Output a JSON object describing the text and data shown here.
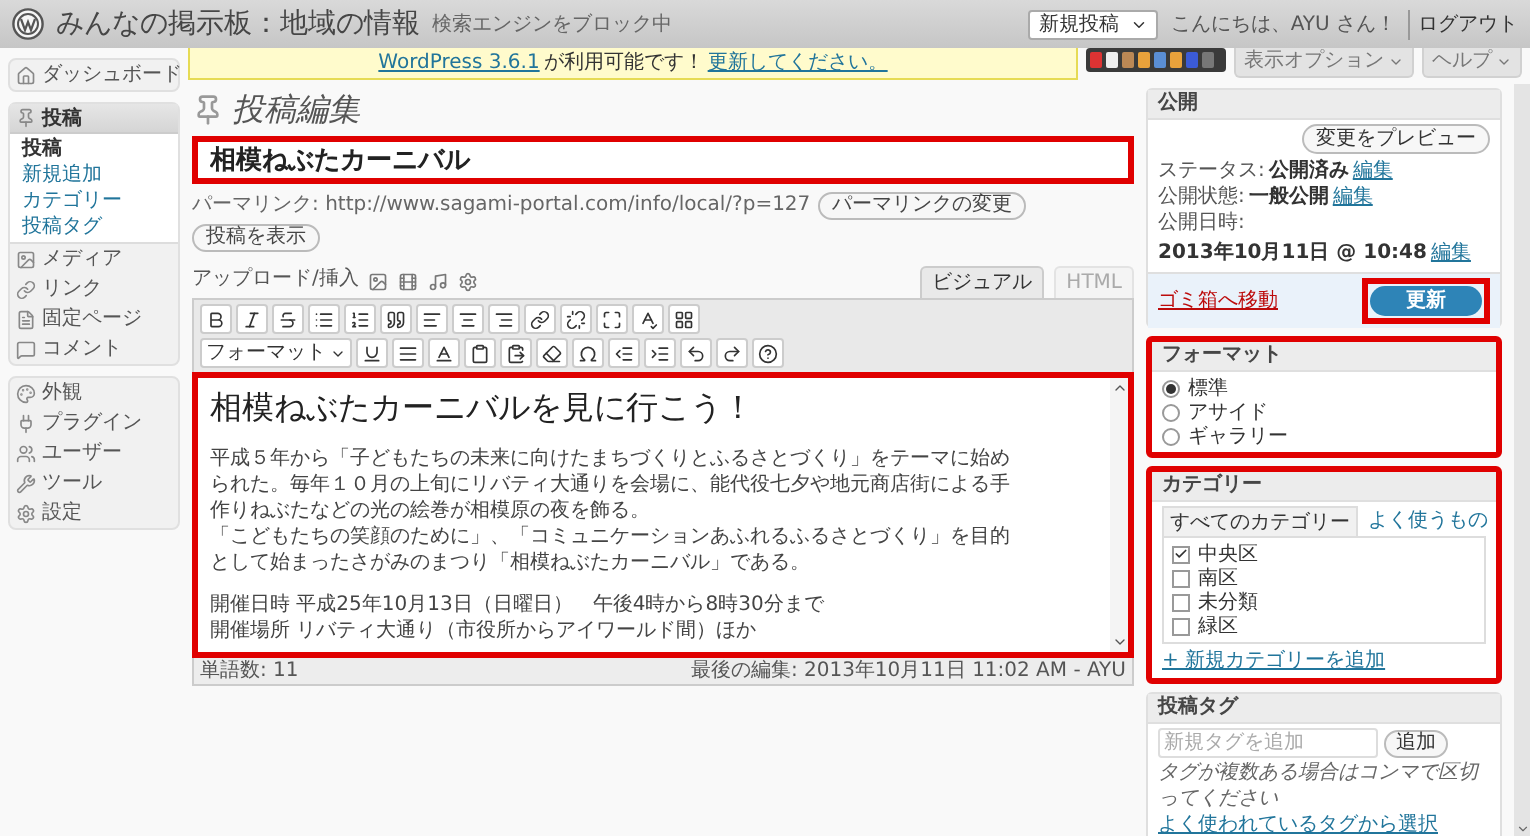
{
  "header": {
    "site_title": "みんなの掲示板：地域の情報",
    "site_note": "検索エンジンをブロック中",
    "new_menu": "新規投稿",
    "greeting": "こんにちは、AYU さん！",
    "logout": "ログアウト"
  },
  "notice": {
    "version_link": "WordPress 3.6.1",
    "text": "が利用可能です！",
    "update_link": "更新してください。"
  },
  "screen_tabs": [
    "表示オプション",
    "ヘルプ"
  ],
  "sidebar": {
    "groups": [
      [
        {
          "label": "ダッシュボード",
          "selected": false
        }
      ],
      [
        {
          "label": "投稿",
          "selected": true,
          "expanded": true,
          "children": [
            {
              "label": "投稿",
              "selected": true
            },
            {
              "label": "新規追加",
              "selected": false
            },
            {
              "label": "カテゴリー",
              "selected": false
            },
            {
              "label": "投稿タグ",
              "selected": false
            }
          ]
        },
        {
          "label": "メディア",
          "selected": false
        },
        {
          "label": "リンク",
          "selected": false
        },
        {
          "label": "固定ページ",
          "selected": false
        },
        {
          "label": "コメント",
          "selected": false
        }
      ],
      [
        {
          "label": "外観",
          "selected": false
        },
        {
          "label": "プラグイン",
          "selected": false
        },
        {
          "label": "ユーザー",
          "selected": false
        },
        {
          "label": "ツール",
          "selected": false
        },
        {
          "label": "設定",
          "selected": false
        }
      ]
    ]
  },
  "page": {
    "heading": "投稿編集"
  },
  "title_field": {
    "value": "相模ねぶたカーニバル",
    "highlighted": true
  },
  "permalink": {
    "label": "パーマリンク:",
    "url": "http://www.sagami-portal.com/info/local/?p=127",
    "buttons": [
      "パーマリンクの変更",
      "投稿を表示"
    ]
  },
  "upload": {
    "label": "アップロード/挿入"
  },
  "editor_tabs": [
    {
      "label": "ビジュアル",
      "selected": true
    },
    {
      "label": "HTML",
      "selected": false
    }
  ],
  "toolbar": {
    "format_select": "フォーマット"
  },
  "editor": {
    "highlighted": true,
    "heading": "相模ねぶたカーニバルを見に行こう！",
    "paragraphs": [
      [
        "平成５年から「子どもたちの未来に向けたまちづくりとふるさとづくり」をテーマに始め",
        "られた。毎年１０月の上旬にリバティ大通りを会場に、能代役七夕や地元商店街による手",
        "作りねぶたなどの光の絵巻が相模原の夜を飾る。",
        "「こどもたちの笑顔のために」、「コミュニケーションあふれるふるさとづくり」を目的",
        "として始まったさがみのまつり「相模ねぶたカーニバル」である。"
      ],
      [
        "開催日時 平成25年10月13日（日曜日）　午後4時から8時30分まで",
        "開催場所 リバティ大通り（市役所からアイワールド間）ほか"
      ]
    ]
  },
  "status": {
    "word_count": "単語数: 11",
    "last_edit": "最後の編集: 2013年10月11日 11:02 AM - AYU"
  },
  "publish": {
    "title": "公開",
    "preview_button": "変更をプレビュー",
    "rows": [
      {
        "label": "ステータス:",
        "value": "公開済み",
        "link": "編集"
      },
      {
        "label": "公開状態:",
        "value": "一般公開",
        "link": "編集"
      },
      {
        "label": "公開日時:",
        "value": "2013年10月11日 @ 10:48",
        "link": "編集"
      }
    ],
    "trash_link": "ゴミ箱へ移動",
    "update_button": "更新",
    "update_highlighted": true
  },
  "format": {
    "title": "フォーマット",
    "highlighted": true,
    "options": [
      {
        "label": "標準",
        "selected": true
      },
      {
        "label": "アサイド",
        "selected": false
      },
      {
        "label": "ギャラリー",
        "selected": false
      }
    ]
  },
  "categories": {
    "title": "カテゴリー",
    "highlighted": true,
    "tabs": [
      {
        "label": "すべてのカテゴリー",
        "selected": true
      },
      {
        "label": "よく使うもの",
        "selected": false
      }
    ],
    "items": [
      {
        "label": "中央区",
        "checked": true
      },
      {
        "label": "南区",
        "checked": false
      },
      {
        "label": "未分類",
        "checked": false
      },
      {
        "label": "緑区",
        "checked": false
      }
    ],
    "add_link": "+ 新規カテゴリーを追加"
  },
  "tags": {
    "title": "投稿タグ",
    "placeholder": "新規タグを追加",
    "button": "追加",
    "hint": "タグが複数ある場合はコンマで区切ってください",
    "choose_link": "よく使われているタグから選択"
  }
}
